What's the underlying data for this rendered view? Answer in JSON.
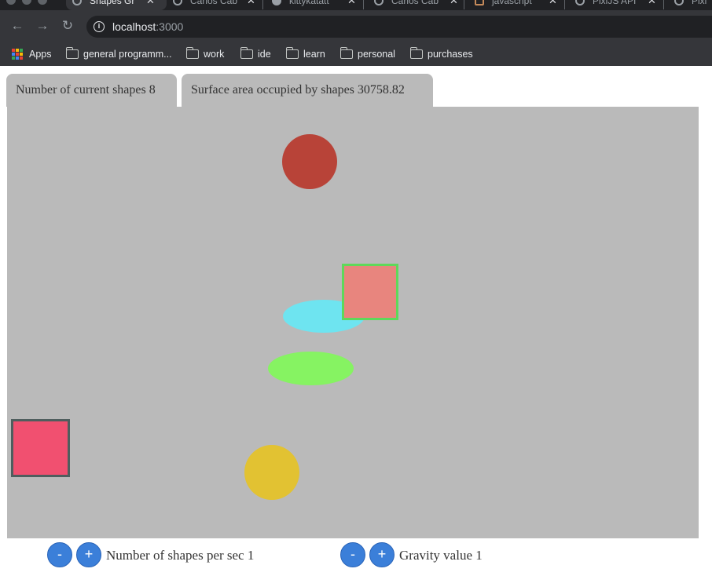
{
  "browser": {
    "tabs": [
      {
        "title": "Shapes Gr",
        "icon": "globe-icon"
      },
      {
        "title": "Carlos Cab",
        "icon": "globe-icon"
      },
      {
        "title": "kittykatatt",
        "icon": "github-icon"
      },
      {
        "title": "Carlos Cab",
        "icon": "globe-icon"
      },
      {
        "title": "javascript",
        "icon": "document-icon"
      },
      {
        "title": "PixiJS API",
        "icon": "globe-icon"
      },
      {
        "title": "Pixi",
        "icon": "globe-icon"
      }
    ],
    "close_glyph": "✕",
    "url_host": "localhost",
    "url_port": ":3000",
    "bookmarks": {
      "apps_label": "Apps",
      "folders": [
        "general programm...",
        "work",
        "ide",
        "learn",
        "personal",
        "purchases"
      ]
    }
  },
  "info": {
    "shapes_count_label": "Number of current shapes 8",
    "surface_area_label": "Surface area occupied by shapes 30758.82"
  },
  "shapes": [
    {
      "type": "circle",
      "fill": "#b84338"
    },
    {
      "type": "ellipse",
      "fill": "#6ee4f0"
    },
    {
      "type": "square",
      "fill": "#e8857e",
      "border": "#5fd85a"
    },
    {
      "type": "ellipse",
      "fill": "#86f362"
    },
    {
      "type": "square",
      "fill": "#f15070",
      "border": "#4f5e5e"
    },
    {
      "type": "circle",
      "fill": "#e2c232"
    }
  ],
  "controls": {
    "minus_label": "-",
    "plus_label": "+",
    "shapes_per_sec_label": "Number of shapes per sec 1",
    "gravity_label": "Gravity value 1"
  },
  "colors": {
    "stage_background": "#bababa",
    "button_blue": "#3b7fd9",
    "chrome_dark": "#35363a"
  }
}
